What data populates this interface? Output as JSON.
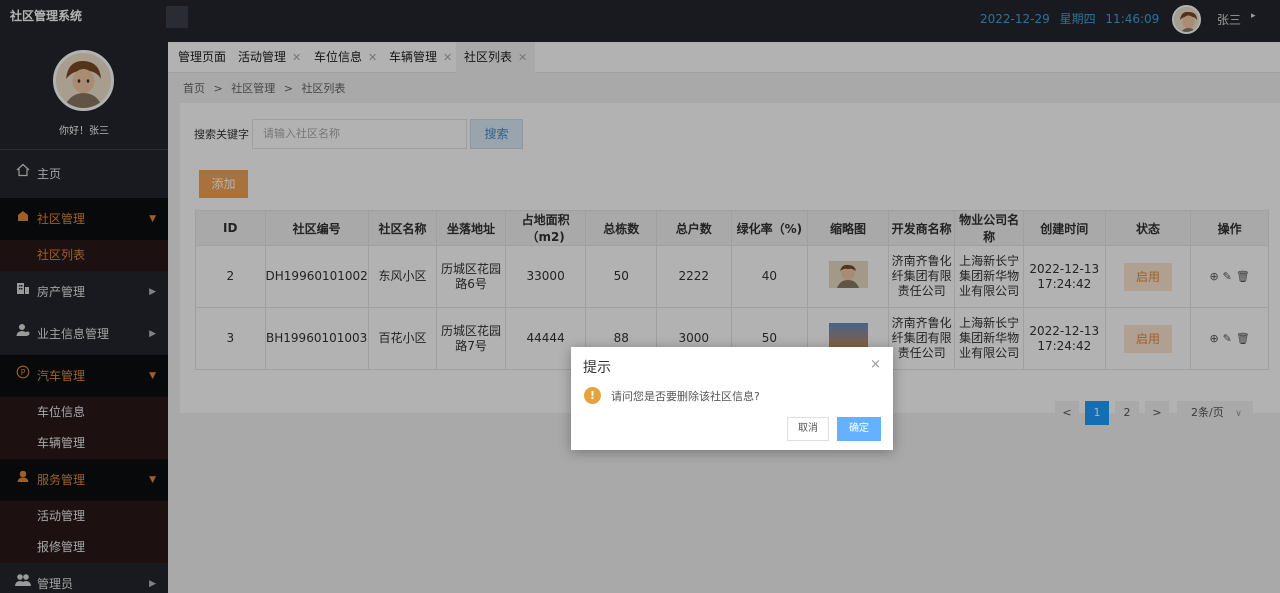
{
  "app": {
    "title": "社区管理系统"
  },
  "header": {
    "date": "2022-12-29",
    "weekday": "星期四",
    "time": "11:46:09",
    "user": "张三",
    "caret_icon": "▸"
  },
  "sidebar": {
    "greeting": "你好！张三",
    "home": "主页",
    "groups": [
      {
        "label": "社区管理",
        "icon": "building-icon",
        "open": true,
        "children": [
          "社区列表"
        ]
      },
      {
        "label": "房产管理",
        "icon": "office-icon",
        "open": false
      },
      {
        "label": "业主信息管理",
        "icon": "user-icon",
        "open": false
      },
      {
        "label": "汽车管理",
        "icon": "parking-icon",
        "open": true,
        "children": [
          "车位信息",
          "车辆管理"
        ]
      },
      {
        "label": "服务管理",
        "icon": "service-icon",
        "open": true,
        "children": [
          "活动管理",
          "报修管理"
        ]
      },
      {
        "label": "管理员",
        "icon": "admins-icon",
        "open": false
      }
    ]
  },
  "tabs": [
    {
      "label": "管理页面",
      "closable": false
    },
    {
      "label": "活动管理",
      "closable": true
    },
    {
      "label": "车位信息",
      "closable": true
    },
    {
      "label": "车辆管理",
      "closable": true
    },
    {
      "label": "社区列表",
      "closable": true,
      "active": true
    }
  ],
  "breadcrumb": {
    "home": "首页",
    "section": "社区管理",
    "page": "社区列表",
    "sep": ">"
  },
  "search": {
    "label": "搜索关键字",
    "placeholder": "请输入社区名称",
    "button": "搜索"
  },
  "toolbar": {
    "add": "添加"
  },
  "table": {
    "headers": [
      "ID",
      "社区编号",
      "社区名称",
      "坐落地址",
      "占地面积（m2)",
      "总栋数",
      "总户数",
      "绿化率（%)",
      "缩略图",
      "开发商名称",
      "物业公司名称",
      "创建时间",
      "状态",
      "操作"
    ],
    "rows": [
      {
        "id": "2",
        "code": "DH19960101002",
        "name": "东风小区",
        "address": "历城区花园路6号",
        "area": "33000",
        "buildings": "50",
        "households": "2222",
        "green_rate": "40",
        "developer": "济南齐鲁化纤集团有限责任公司",
        "property": "上海新长宁集团新华物业有限公司",
        "created": "2022-12-13 17:24:42",
        "status": "启用"
      },
      {
        "id": "3",
        "code": "BH19960101003",
        "name": "百花小区",
        "address": "历城区花园路7号",
        "area": "44444",
        "buildings": "88",
        "households": "3000",
        "green_rate": "50",
        "developer": "济南齐鲁化纤集团有限责任公司",
        "property": "上海新长宁集团新华物业有限公司",
        "created": "2022-12-13 17:24:42",
        "status": "启用"
      }
    ]
  },
  "pagination": {
    "prev": "<",
    "pages": [
      "1",
      "2"
    ],
    "current": "1",
    "next": ">",
    "page_size": "2条/页"
  },
  "dialog": {
    "title": "提示",
    "message": "请问您是否要删除该社区信息?",
    "cancel": "取消",
    "confirm": "确定",
    "close_icon": "×",
    "warning_icon": "!"
  },
  "colors": {
    "accent": "#e6893a",
    "primary": "#1e9fff",
    "sidebar": "#23262e"
  }
}
